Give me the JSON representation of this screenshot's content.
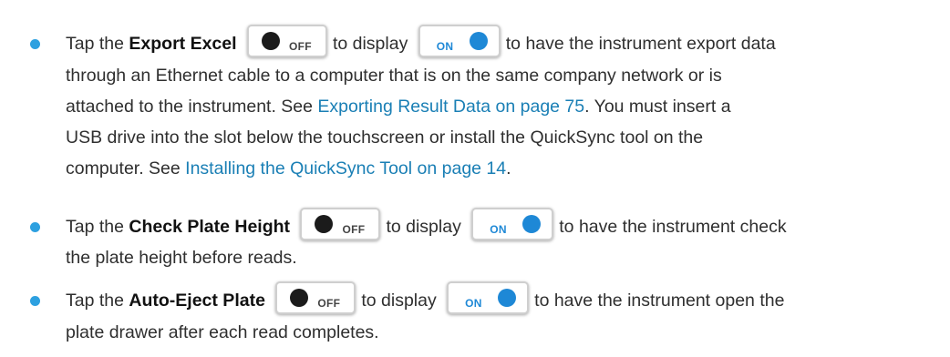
{
  "cut_text": "                                                                              ",
  "items": [
    {
      "lead": "Tap the ",
      "bold": "Export Excel",
      "mid": "to display",
      "tail": "to have the instrument export data",
      "line2": "through an Ethernet cable to a computer that is on the same company network or is",
      "line3_pre": "attached to the instrument. See ",
      "line3_link": "Exporting Result Data on page 75",
      "line3_post": ". You must insert a",
      "line4": "USB drive into the slot below the touchscreen or install the QuickSync tool on the",
      "line5_pre": "computer. See ",
      "line5_link": "Installing the QuickSync Tool on page 14",
      "line5_post": "."
    },
    {
      "lead": "Tap the ",
      "bold": "Check Plate Height",
      "mid": "to display",
      "tail": "to have the instrument check",
      "line2": "the plate height before reads."
    },
    {
      "lead": "Tap the ",
      "bold": "Auto-Eject Plate",
      "mid": "to display",
      "tail": "to have the instrument open the",
      "line2": "plate drawer after each read completes."
    }
  ],
  "toggle_off_label": "OFF",
  "toggle_on_label": "ON",
  "colors": {
    "bullet": "#2da0e0",
    "link": "#1a7fb5",
    "toggle_on": "#1e88d6"
  }
}
